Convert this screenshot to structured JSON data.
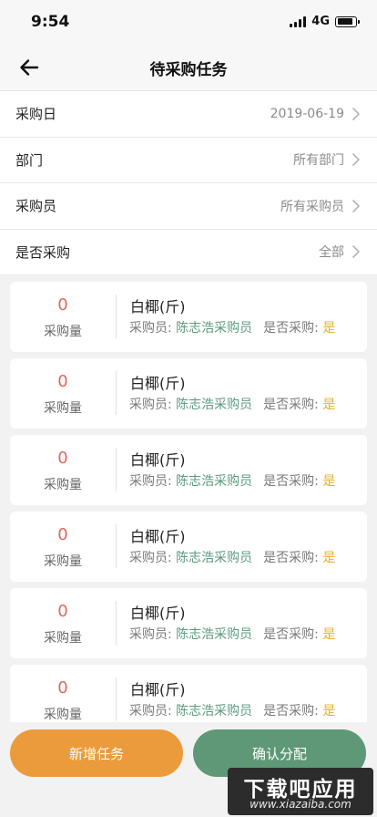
{
  "status_bar": {
    "time": "9:54",
    "network": "4G",
    "battery_level": 0.85
  },
  "nav": {
    "title": "待采购任务",
    "back_icon": "arrow-left-icon"
  },
  "filters": [
    {
      "label": "采购日",
      "value": "2019-06-19"
    },
    {
      "label": "部门",
      "value": "所有部门"
    },
    {
      "label": "采购员",
      "value": "所有采购员"
    },
    {
      "label": "是否采购",
      "value": "全部"
    }
  ],
  "tasks": [
    {
      "quantity": "0",
      "quantity_label": "采购量",
      "name": "白椰(斤)",
      "buyer_label": "采购员: ",
      "buyer": "陈志浩采购员",
      "purchased_label": "是否采购: ",
      "purchased": "是"
    },
    {
      "quantity": "0",
      "quantity_label": "采购量",
      "name": "白椰(斤)",
      "buyer_label": "采购员: ",
      "buyer": "陈志浩采购员",
      "purchased_label": "是否采购: ",
      "purchased": "是"
    },
    {
      "quantity": "0",
      "quantity_label": "采购量",
      "name": "白椰(斤)",
      "buyer_label": "采购员: ",
      "buyer": "陈志浩采购员",
      "purchased_label": "是否采购: ",
      "purchased": "是"
    },
    {
      "quantity": "0",
      "quantity_label": "采购量",
      "name": "白椰(斤)",
      "buyer_label": "采购员: ",
      "buyer": "陈志浩采购员",
      "purchased_label": "是否采购: ",
      "purchased": "是"
    },
    {
      "quantity": "0",
      "quantity_label": "采购量",
      "name": "白椰(斤)",
      "buyer_label": "采购员: ",
      "buyer": "陈志浩采购员",
      "purchased_label": "是否采购: ",
      "purchased": "是"
    },
    {
      "quantity": "0",
      "quantity_label": "采购量",
      "name": "白椰(斤)",
      "buyer_label": "采购员: ",
      "buyer": "陈志浩采购员",
      "purchased_label": "是否采购: ",
      "purchased": "是"
    }
  ],
  "actions": {
    "add_label": "新增任务",
    "confirm_label": "确认分配"
  },
  "watermark": {
    "title": "下载吧应用",
    "url": "www.xiazaiba.com"
  },
  "colors": {
    "quantity": "#e0685c",
    "buyer": "#5b9a7c",
    "purchased_yes": "#e5b12a",
    "add_button": "#ec9b3c",
    "confirm_button": "#5e9877"
  }
}
